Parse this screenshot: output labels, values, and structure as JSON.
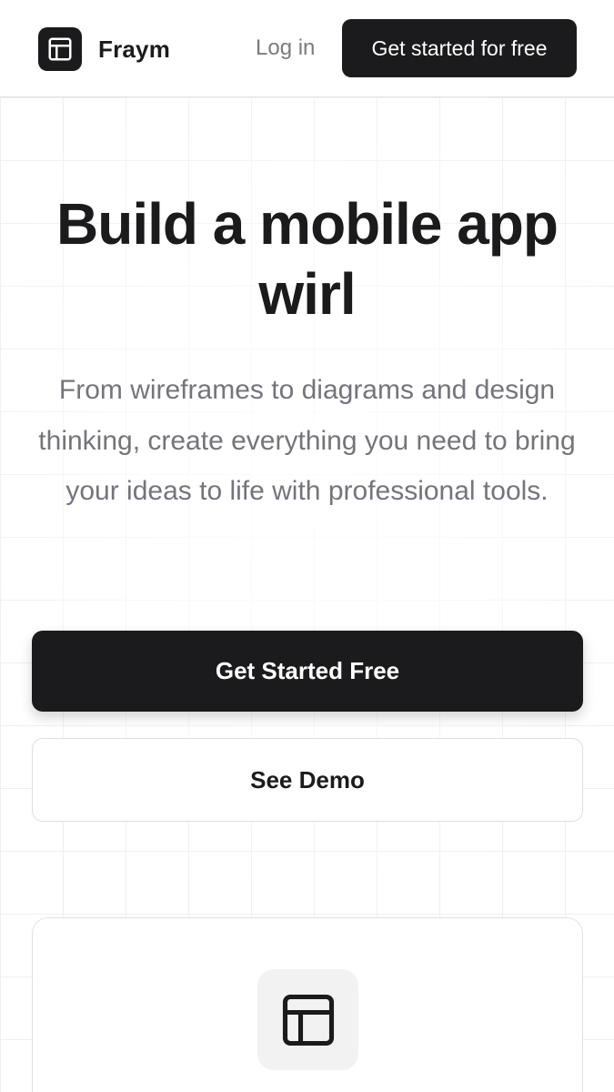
{
  "header": {
    "brand_name": "Fraym",
    "logo_icon": "layout-icon",
    "login_label": "Log in",
    "cta_label": "Get started for free"
  },
  "hero": {
    "title": "Build a mobile app wirl",
    "subtitle": "From wireframes to diagrams and design thinking, create everything you need to bring your ideas to life with professional tools.",
    "primary_button": "Get Started Free",
    "secondary_button": "See Demo"
  },
  "feature_card": {
    "icon": "layout-icon"
  },
  "colors": {
    "primary": "#1b1b1d",
    "muted_text": "#74747c",
    "grid_line": "#efeff1",
    "icon_bg": "#f2f2f3"
  }
}
